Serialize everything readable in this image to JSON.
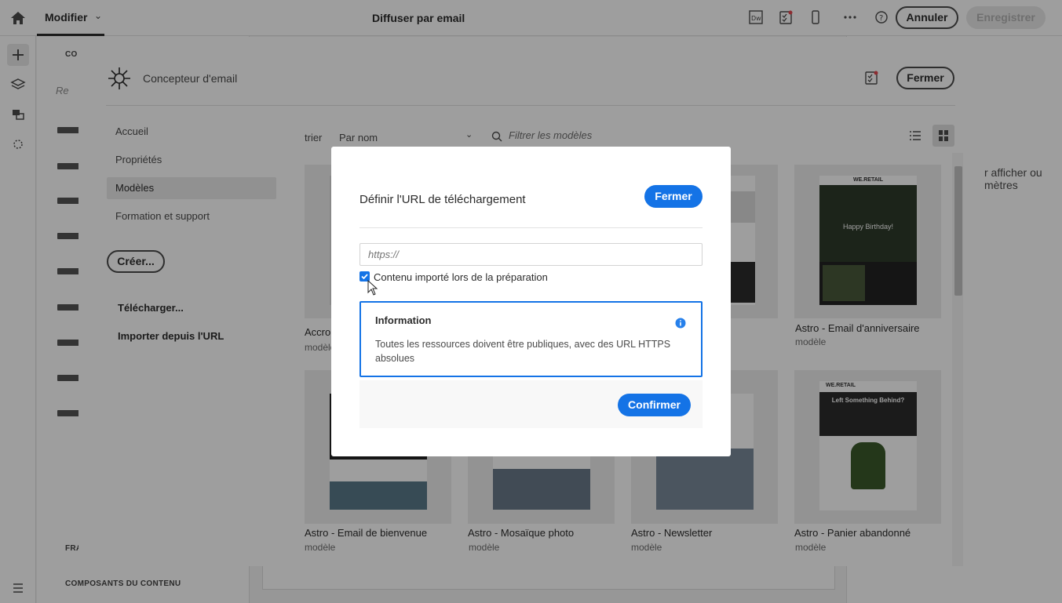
{
  "topbar": {
    "modifier_label": "Modifier",
    "title": "Diffuser par email",
    "annuler_label": "Annuler",
    "enregistrer_label": "Enregistrer"
  },
  "side_panel": {
    "top_section": "CO",
    "search_placeholder": "Re",
    "section_frag": "FRA",
    "section_content": "COMPOSANTS DU CONTENU"
  },
  "right_panel": {
    "text_line1": "r afficher ou",
    "text_line2": "mètres"
  },
  "designer": {
    "title": "Concepteur d'email",
    "fermer_label": "Fermer",
    "nav": [
      {
        "label": "Accueil"
      },
      {
        "label": "Propriétés"
      },
      {
        "label": "Modèles",
        "selected": true
      },
      {
        "label": "Formation et support"
      }
    ],
    "creer_label": "Créer...",
    "telecharger_label": "Télécharger...",
    "importer_label": "Importer depuis l'URL",
    "sort_label": "trier",
    "sort_value": "Par nom",
    "filter_placeholder": "Filtrer les modèles",
    "cards": [
      {
        "title": "Accro",
        "sub": "modèle"
      },
      {
        "title": "Astro - Email d'anniversaire",
        "sub": "modèle",
        "thumb_brand": "WE.RETAIL",
        "thumb_heading": "Happy Birthday!"
      },
      {
        "title": "Astro - Email de bienvenue",
        "sub": "modèle"
      },
      {
        "title": "Astro - Mosaïque photo",
        "sub": "modèle"
      },
      {
        "title": "Astro - Newsletter",
        "sub": "modèle"
      },
      {
        "title": "Astro - Panier abandonné",
        "sub": "modèle",
        "thumb_brand": "WE.RETAIL",
        "thumb_heading": "Left Something Behind?"
      }
    ]
  },
  "modal": {
    "title": "Définir l'URL de téléchargement",
    "fermer_label": "Fermer",
    "url_placeholder": "https://",
    "checkbox_label": "Contenu importé lors de la préparation",
    "checkbox_checked": true,
    "info_title": "Information",
    "info_text": "Toutes les ressources doivent être publiques, avec des URL HTTPS absolues",
    "confirm_label": "Confirmer"
  },
  "colors": {
    "accent": "#1473e6",
    "text": "#2c2c2c"
  }
}
